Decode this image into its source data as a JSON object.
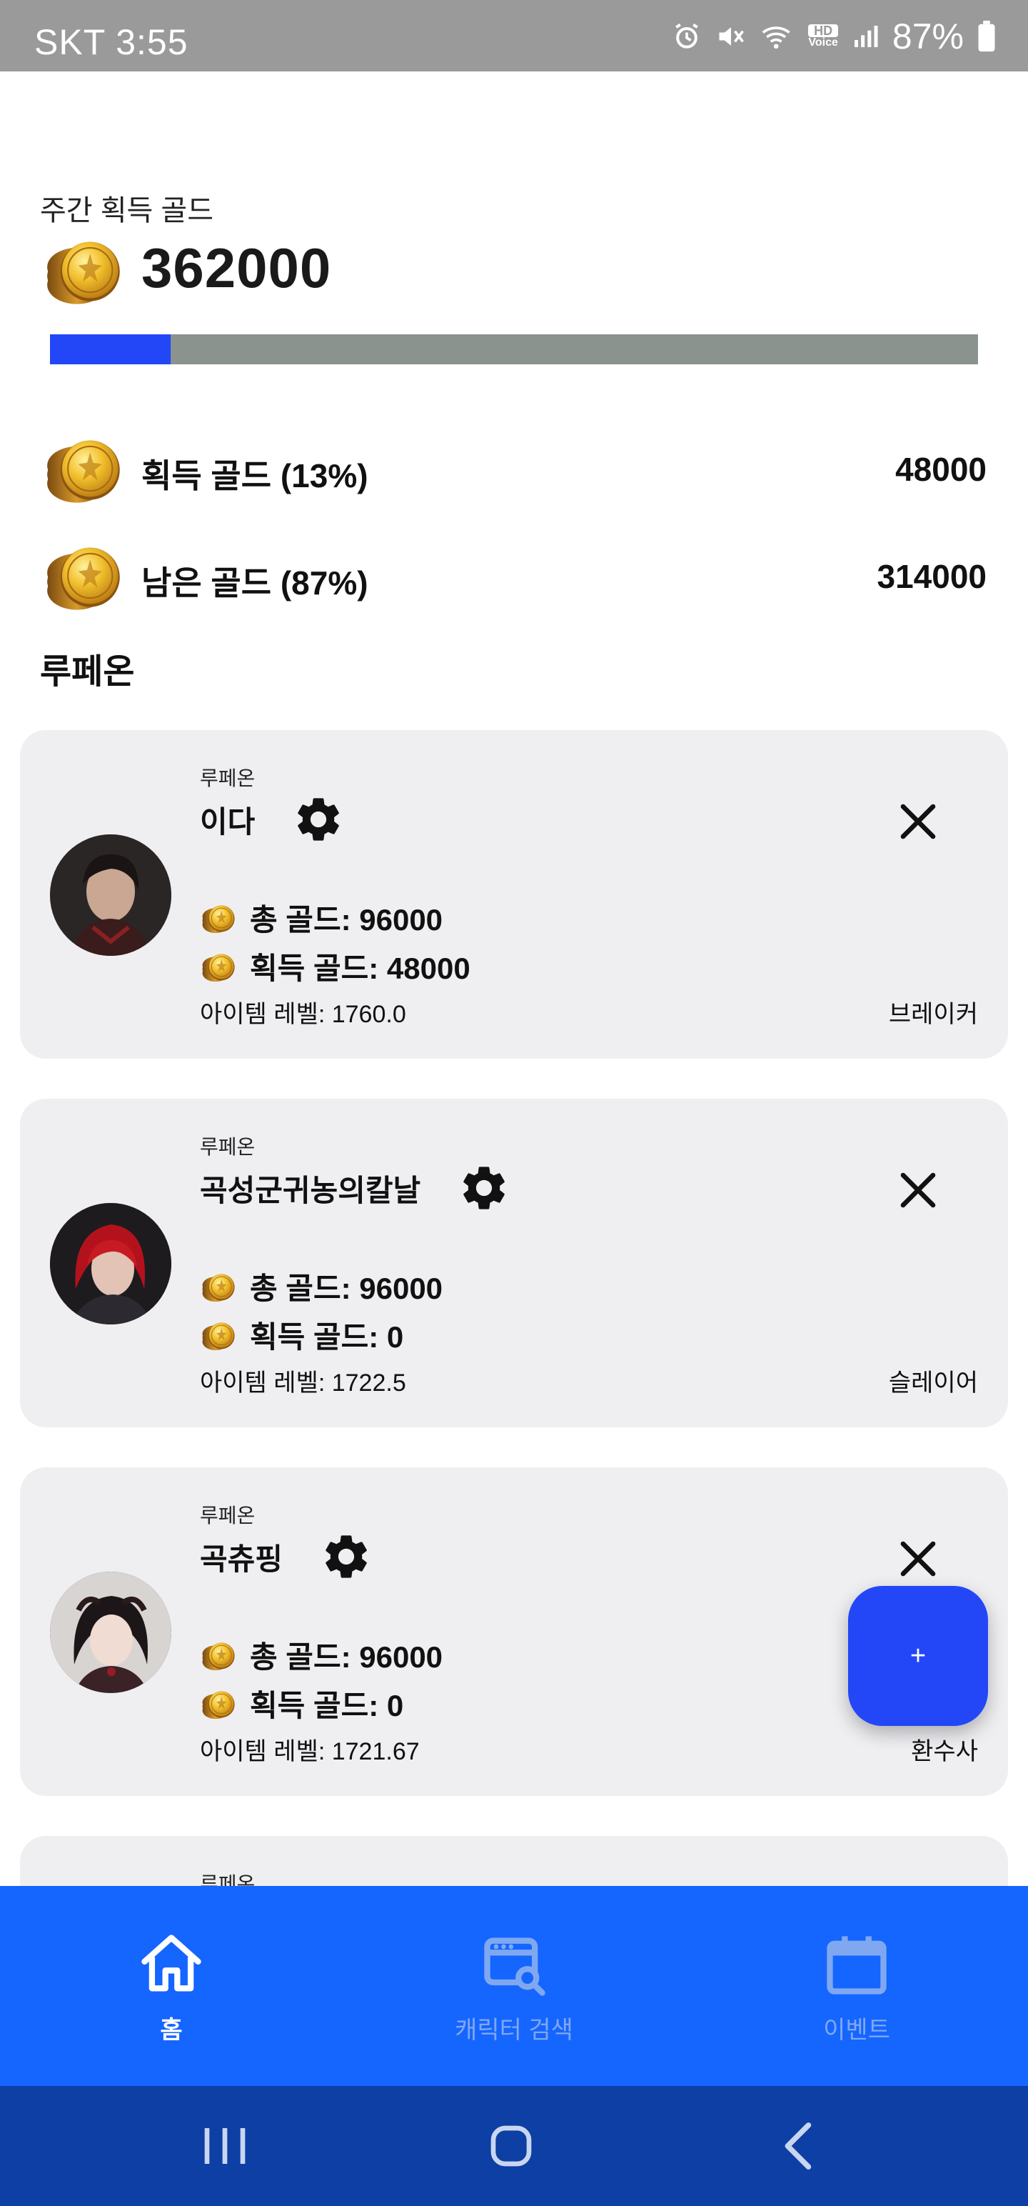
{
  "status_bar": {
    "time": "SKT 3:55",
    "battery": "87%",
    "hd_voice_top": "HD",
    "hd_voice_bottom": "Voice",
    "icons": [
      "alarm-icon",
      "mute-icon",
      "wifi-icon",
      "hd-voice-icon",
      "signal-icon",
      "battery-icon"
    ]
  },
  "summary": {
    "weekly_label": "주간 획득 골드",
    "total_gold": "362000",
    "progress_fraction": 0.13,
    "earned_label": "획득 골드 (13%)",
    "earned_value": "48000",
    "remaining_label": "남은 골드 (87%)",
    "remaining_value": "314000"
  },
  "section_title": "루페온",
  "characters": [
    {
      "server": "루페온",
      "name": "이다",
      "total_gold": "총 골드: 96000",
      "earned_gold": "획득 골드: 48000",
      "item_level": "아이템 레벨: 1760.0",
      "class": "브레이커"
    },
    {
      "server": "루페온",
      "name": "곡성군귀농의칼날",
      "total_gold": "총 골드: 96000",
      "earned_gold": "획득 골드: 0",
      "item_level": "아이템 레벨: 1722.5",
      "class": "슬레이어"
    },
    {
      "server": "루페온",
      "name": "곡츄핑",
      "total_gold": "총 골드: 96000",
      "earned_gold": "획득 골드: 0",
      "item_level": "아이템 레벨: 1721.67",
      "class": "환수사"
    },
    {
      "server": "루페온"
    }
  ],
  "fab": {
    "label": "+"
  },
  "bottom_nav": [
    {
      "label": "홈",
      "icon": "home-icon",
      "active": true
    },
    {
      "label": "캐릭터 검색",
      "icon": "character-search-icon",
      "active": false
    },
    {
      "label": "이벤트",
      "icon": "calendar-icon",
      "active": false
    }
  ],
  "colors": {
    "accent": "#2347f7",
    "nav_bar": "#1565ff",
    "system_nav": "#0d3fa4",
    "card_bg": "#efeff2",
    "progress_track": "#8a938d"
  }
}
